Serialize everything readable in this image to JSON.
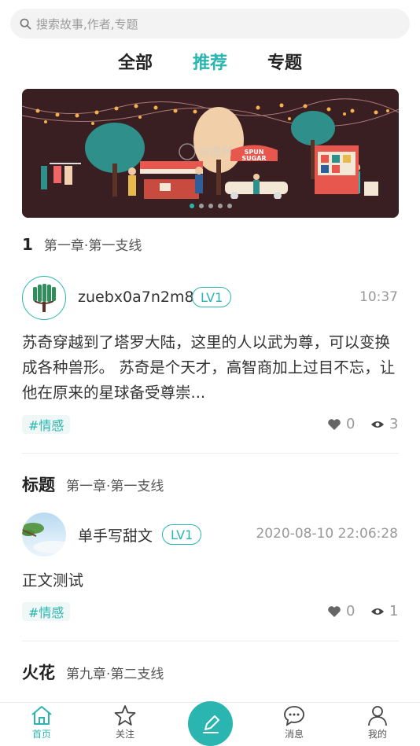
{
  "search": {
    "placeholder": "搜索故事,作者,专题"
  },
  "tabs": [
    {
      "label": "全部",
      "active": false
    },
    {
      "label": "推荐",
      "active": true
    },
    {
      "label": "专题",
      "active": false
    }
  ],
  "banner": {
    "dots_total": 5,
    "active_dot": 0,
    "sign_text_1": "SPUN",
    "sign_text_2": "SUGAR"
  },
  "posts": [
    {
      "number": "1",
      "chapter": "第一章·第一支线",
      "author": "zuebx0a7n2m8",
      "level": "LV1",
      "time": "10:37",
      "body": "苏奇穿越到了塔罗大陆，这里的人以武为尊，可以变换成各种兽形。 苏奇是个天才，高智商加上过目不忘，让他在原来的星球备受尊崇...",
      "tag": "#情感",
      "likes": "0",
      "views": "3"
    },
    {
      "title": "标题",
      "chapter": "第一章·第一支线",
      "author": "单手写甜文",
      "level": "LV1",
      "time": "2020-08-10 22:06:28",
      "body": "正文测试",
      "tag": "#情感",
      "likes": "0",
      "views": "1"
    },
    {
      "title": "火花",
      "chapter": "第九章·第二支线"
    }
  ],
  "bottom_nav": [
    {
      "label": "首页",
      "icon": "home-icon",
      "active": true
    },
    {
      "label": "关注",
      "icon": "star-icon",
      "active": false
    },
    {
      "label": "",
      "icon": "pen-icon",
      "active": false
    },
    {
      "label": "消息",
      "icon": "chat-icon",
      "active": false
    },
    {
      "label": "我的",
      "icon": "user-icon",
      "active": false
    }
  ],
  "colors": {
    "accent": "#2ab5b0",
    "text": "#333333",
    "muted": "#999999"
  }
}
